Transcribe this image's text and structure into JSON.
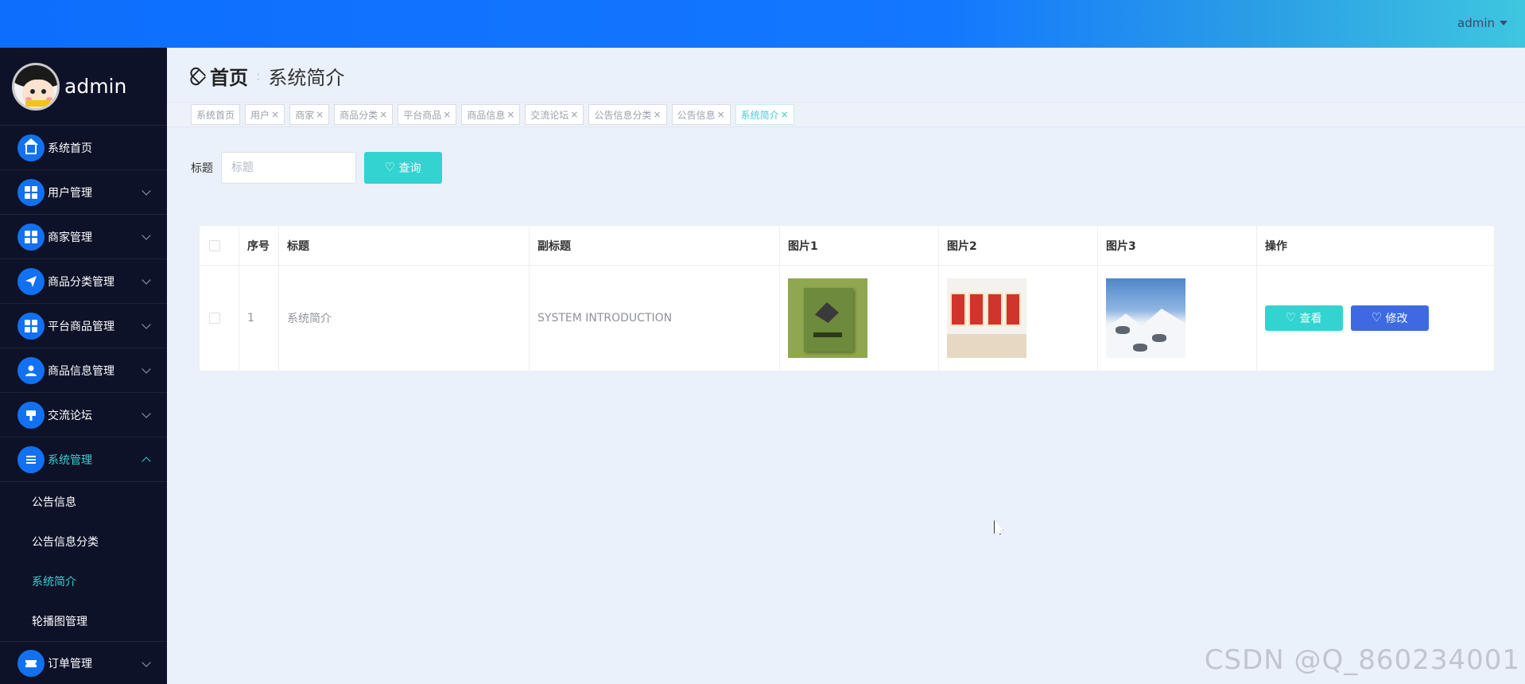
{
  "topbar": {
    "user": "admin"
  },
  "sidebar": {
    "profile_name": "admin",
    "items": [
      {
        "label": "系统首页",
        "icon": "home-icon",
        "has_children": false
      },
      {
        "label": "用户管理",
        "icon": "grid-icon",
        "has_children": true
      },
      {
        "label": "商家管理",
        "icon": "grid-icon",
        "has_children": true
      },
      {
        "label": "商品分类管理",
        "icon": "paper-plane-icon",
        "has_children": true
      },
      {
        "label": "平台商品管理",
        "icon": "grid-icon",
        "has_children": true
      },
      {
        "label": "商品信息管理",
        "icon": "user-icon",
        "has_children": true
      },
      {
        "label": "交流论坛",
        "icon": "brush-icon",
        "has_children": true
      },
      {
        "label": "系统管理",
        "icon": "list-icon",
        "has_children": true,
        "expanded": true
      }
    ],
    "sub_items": [
      {
        "label": "公告信息"
      },
      {
        "label": "公告信息分类"
      },
      {
        "label": "系统简介",
        "active": true
      },
      {
        "label": "轮播图管理"
      }
    ],
    "last_item": {
      "label": "订单管理",
      "icon": "ticket-icon"
    }
  },
  "breadcrumb": {
    "home": "首页",
    "current": "系统简介"
  },
  "tabs": [
    {
      "label": "系统首页",
      "closable": false
    },
    {
      "label": "用户",
      "closable": true
    },
    {
      "label": "商家",
      "closable": true
    },
    {
      "label": "商品分类",
      "closable": true
    },
    {
      "label": "平台商品",
      "closable": true
    },
    {
      "label": "商品信息",
      "closable": true
    },
    {
      "label": "交流论坛",
      "closable": true
    },
    {
      "label": "公告信息分类",
      "closable": true
    },
    {
      "label": "公告信息",
      "closable": true
    },
    {
      "label": "系统简介",
      "closable": true,
      "active": true
    }
  ],
  "search": {
    "label": "标题",
    "placeholder": "标题",
    "button": "查询"
  },
  "table": {
    "columns": [
      "序号",
      "标题",
      "副标题",
      "图片1",
      "图片2",
      "图片3",
      "操作"
    ],
    "rows": [
      {
        "index": "1",
        "title": "系统简介",
        "subtitle": "SYSTEM INTRODUCTION"
      }
    ],
    "actions": {
      "view": "查看",
      "edit": "修改"
    }
  },
  "watermark": "CSDN @Q_860234001",
  "colors": {
    "accent": "#32d3d0",
    "primary": "#3d6ae0",
    "sidebar_bg": "#0d1228",
    "topbar": "#1477ff"
  }
}
